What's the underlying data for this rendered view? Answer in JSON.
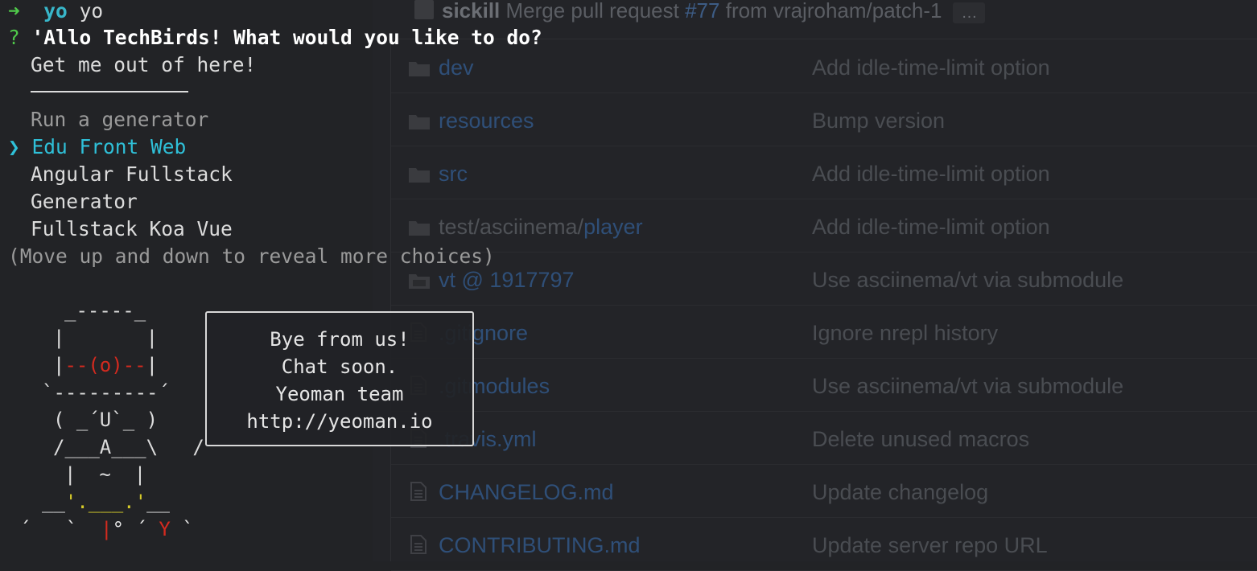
{
  "github": {
    "commit": {
      "author": "sickill",
      "message_prefix": "Merge pull request",
      "pr_number": "#77",
      "message_suffix": "from vrajroham/patch-1",
      "more": "…"
    },
    "files": [
      {
        "type": "folder",
        "name": "dev",
        "message": "Add idle-time-limit option"
      },
      {
        "type": "folder",
        "name": "resources",
        "message": "Bump version"
      },
      {
        "type": "folder",
        "name": "src",
        "message": "Add idle-time-limit option"
      },
      {
        "type": "folder",
        "dir": "test/asciinema/",
        "name": "player",
        "message": "Add idle-time-limit option"
      },
      {
        "type": "submodule",
        "name": "vt @ 1917797",
        "message": "Use asciinema/vt via submodule"
      },
      {
        "type": "file",
        "name": ".gitignore",
        "message": "Ignore nrepl history"
      },
      {
        "type": "file",
        "name": ".gitmodules",
        "message": "Use asciinema/vt via submodule"
      },
      {
        "type": "file",
        "name": ".travis.yml",
        "message": "Delete unused macros"
      },
      {
        "type": "file",
        "name": "CHANGELOG.md",
        "message": "Update changelog"
      },
      {
        "type": "file",
        "name": "CONTRIBUTING.md",
        "message": "Update server repo URL"
      }
    ]
  },
  "terminal": {
    "prompt_arrow": "➜",
    "prompt_dir": "yo",
    "command": "yo",
    "question_mark": "?",
    "question": "'Allo TechBirds! What would you like to do?",
    "menu": {
      "exit_option": "Get me out of here!",
      "section_title": "Run a generator",
      "pointer": "❯",
      "options": [
        "Edu Front Web",
        "Angular Fullstack",
        "Generator",
        "Fullstack Koa Vue"
      ],
      "selected_index": 0,
      "hint": "(Move up and down to reveal more choices)"
    },
    "bubble": {
      "lines": [
        "Bye from us!",
        "Chat soon.",
        "Yeoman team",
        "http://yeoman.io"
      ]
    },
    "colors": {
      "prompt": "#4fc84a",
      "selected": "#2fc0d8",
      "yeoman_red": "#d42a1f",
      "yeoman_yellow": "#d8cc2a"
    }
  }
}
